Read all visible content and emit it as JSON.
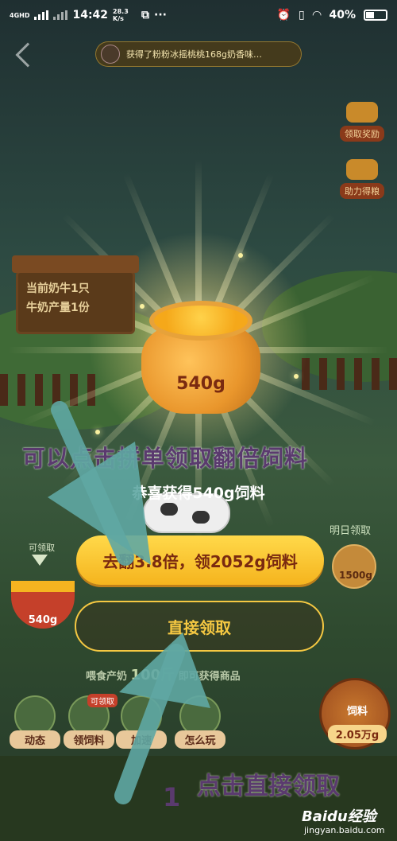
{
  "status_bar": {
    "network": "4GHD",
    "time": "14:42",
    "speed": "28.3 K/s",
    "battery": "40%"
  },
  "header": {
    "ticker_text": "获得了粉粉冰摇桃桃168g奶香味…"
  },
  "side_buttons": {
    "claim_reward": "领取奖励",
    "help_feed": "助力得粮"
  },
  "farm_sign": {
    "line1": "当前奶牛1只",
    "line2": "牛奶产量1份"
  },
  "bag_amount": "540g",
  "annotation_top": "可以点击拼单领取翻倍饲料",
  "congrats": "恭喜获得540g饲料",
  "buttons": {
    "double": "去翻3.8倍，领2052g饲料",
    "direct": "直接领取"
  },
  "tomorrow": {
    "label": "明日领取",
    "amount": "1500g"
  },
  "claimable": {
    "label": "可领取",
    "amount": "540g"
  },
  "hint": {
    "prefix": "喂食产奶",
    "amount": "100斤",
    "suffix": "即可获得商品"
  },
  "bottom_nav": [
    {
      "label": "动态"
    },
    {
      "label": "领饲料",
      "tag": "可领取"
    },
    {
      "label": "加速"
    },
    {
      "label": "怎么玩"
    }
  ],
  "feed_store": {
    "title": "饲料",
    "amount": "2.05万g"
  },
  "annotation_bottom": {
    "number": "1",
    "text": "点击直接领取"
  },
  "watermark": {
    "brand": "Baidu经验",
    "url": "jingyan.baidu.com"
  },
  "colors": {
    "accent_yellow": "#f5b41e",
    "annotation_purple": "#5a3a6e",
    "arrow_teal": "#5fa7a3"
  }
}
